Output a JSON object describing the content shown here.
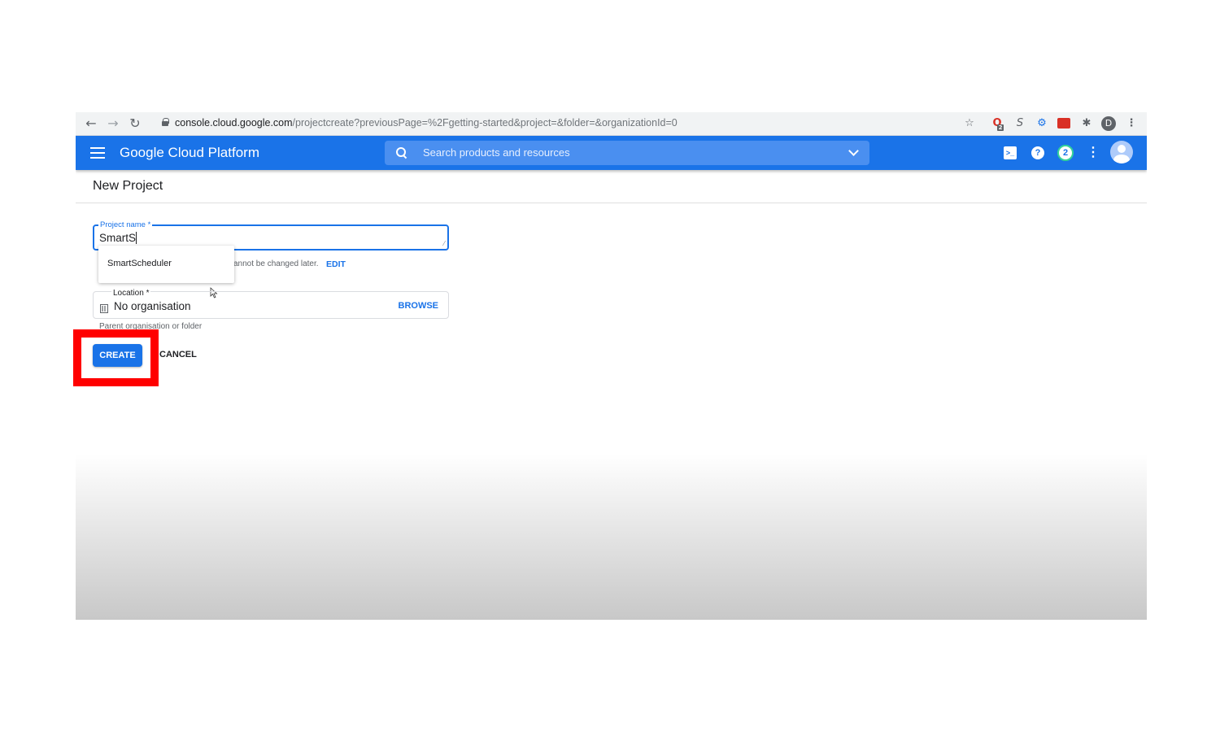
{
  "browser": {
    "back_icon": "arrow-left-icon",
    "forward_icon": "arrow-right-icon",
    "reload_icon": "reload-icon",
    "url_host": "console.cloud.google.com",
    "url_path": "/projectcreate?previousPage=%2Fgetting-started&project=&folder=&organizationId=0",
    "profile_initial": "D",
    "extension_badge": "2"
  },
  "header": {
    "title": "Google Cloud Platform",
    "search_placeholder": "Search products and resources",
    "notifications_count": "2"
  },
  "page": {
    "title": "New Project"
  },
  "form": {
    "project_name_label": "Project name *",
    "project_name_value": "SmartS",
    "autocomplete_suggestion": "SmartScheduler",
    "project_id_text": "annot be changed later.",
    "edit_label": "EDIT",
    "location_label": "Location *",
    "location_value": "No organisation",
    "browse_label": "BROWSE",
    "location_helper": "Parent organisation or folder",
    "create_label": "CREATE",
    "cancel_label": "CANCEL"
  },
  "colors": {
    "brand_blue": "#1a73e8",
    "highlight_red": "#ff0000"
  }
}
